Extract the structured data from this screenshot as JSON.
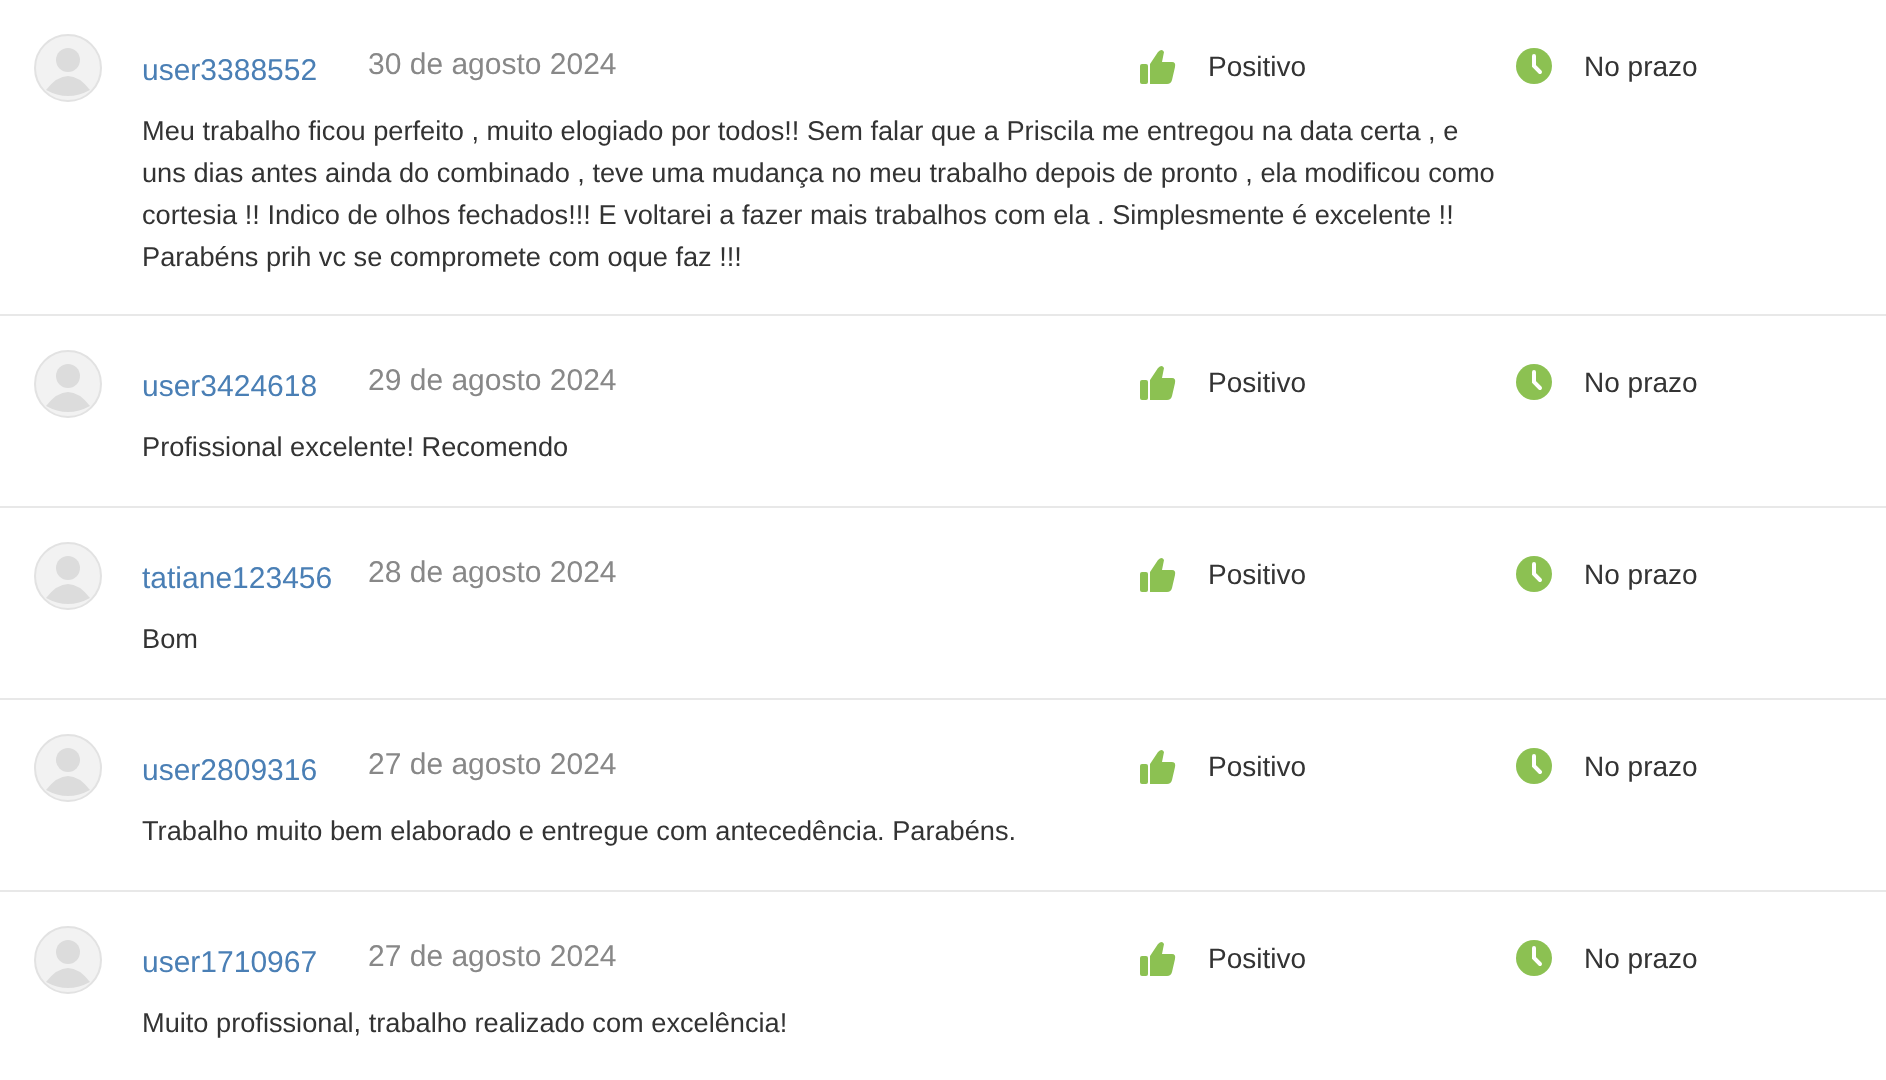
{
  "reviews": [
    {
      "user": "user3388552",
      "date": "30 de agosto 2024",
      "rating": {
        "kind": "positive",
        "label": "Positivo"
      },
      "deadline": {
        "kind": "on_time",
        "label": "No prazo"
      },
      "comment": "Meu trabalho ficou perfeito , muito elogiado por todos!! Sem falar que a Priscila me entregou na data certa , e uns dias antes ainda do combinado , teve uma mudança no meu trabalho depois de pronto , ela modificou como cortesia !! Indico de olhos fechados!!! E voltarei a fazer mais trabalhos com ela . Simplesmente é excelente !! Parabéns prih vc se compromete com oque faz !!!"
    },
    {
      "user": "user3424618",
      "date": "29 de agosto 2024",
      "rating": {
        "kind": "positive",
        "label": "Positivo"
      },
      "deadline": {
        "kind": "on_time",
        "label": "No prazo"
      },
      "comment": "Profissional excelente! Recomendo"
    },
    {
      "user": "tatiane123456",
      "date": "28 de agosto 2024",
      "rating": {
        "kind": "positive",
        "label": "Positivo"
      },
      "deadline": {
        "kind": "on_time",
        "label": "No prazo"
      },
      "comment": "Bom"
    },
    {
      "user": "user2809316",
      "date": "27 de agosto 2024",
      "rating": {
        "kind": "positive",
        "label": "Positivo"
      },
      "deadline": {
        "kind": "on_time",
        "label": "No prazo"
      },
      "comment": "Trabalho muito bem elaborado e entregue com antecedência. Parabéns."
    },
    {
      "user": "user1710967",
      "date": "27 de agosto 2024",
      "rating": {
        "kind": "positive",
        "label": "Positivo"
      },
      "deadline": {
        "kind": "on_time",
        "label": "No prazo"
      },
      "comment": "Muito profissional, trabalho realizado com excelência!"
    }
  ]
}
